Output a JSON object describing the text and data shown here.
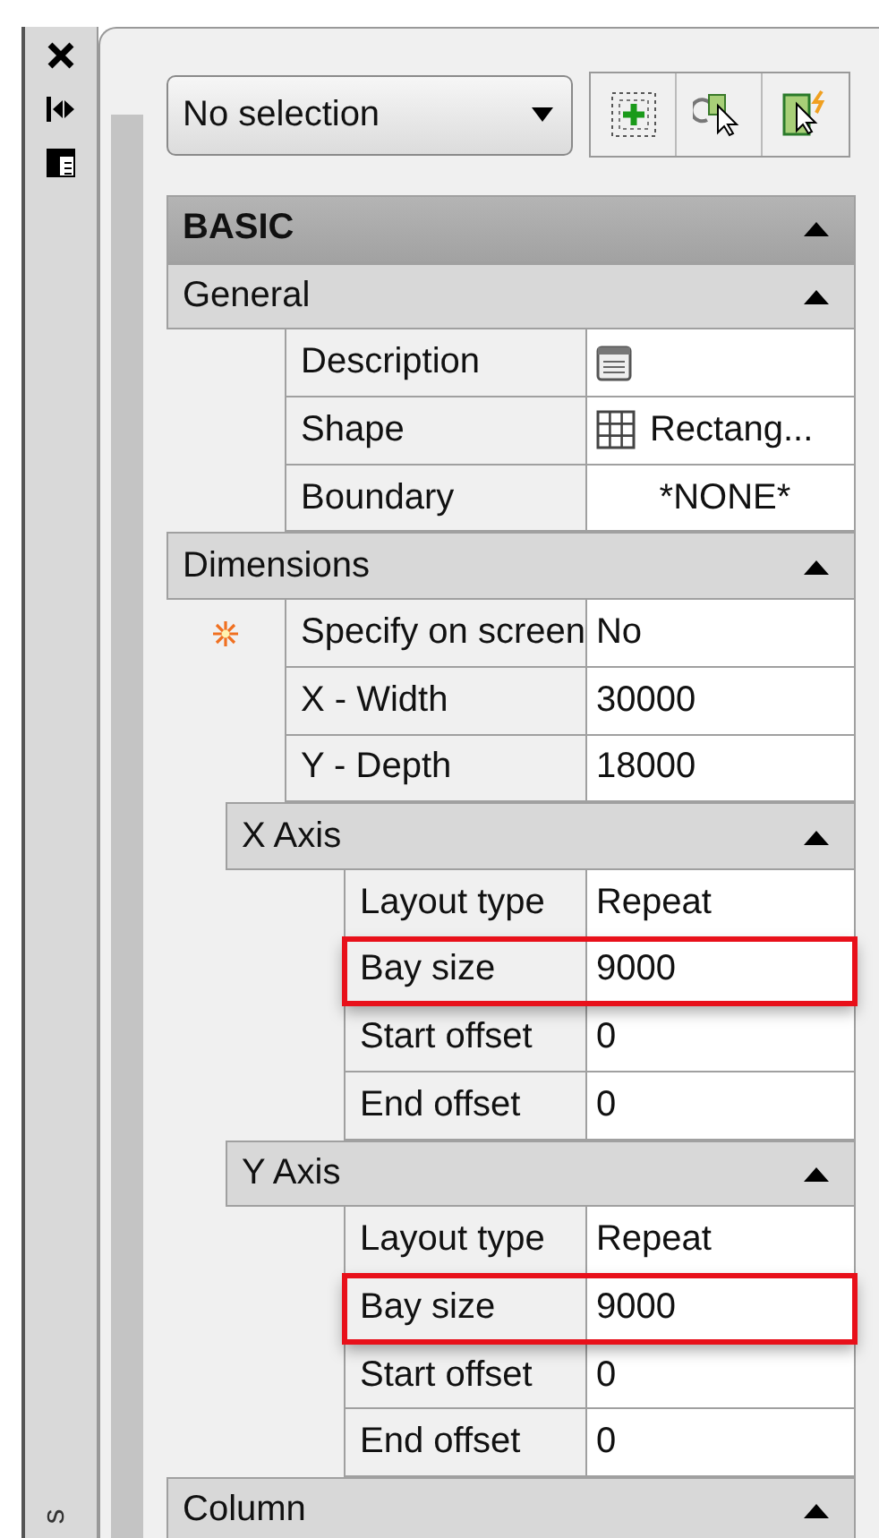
{
  "side_toolbar": {
    "label": "s"
  },
  "selection": {
    "value": "No selection"
  },
  "properties": [
    {
      "kind": "category",
      "title": "BASIC",
      "expanded": true,
      "children": [
        {
          "kind": "group",
          "title": "General",
          "expanded": true,
          "children": [
            {
              "kind": "editor",
              "label": "Description",
              "flagged": false,
              "highlighted": false
            },
            {
              "kind": "shape",
              "label": "Shape",
              "value": "Rectang...",
              "flagged": false,
              "highlighted": false
            },
            {
              "kind": "centered",
              "label": "Boundary",
              "value": "*NONE*",
              "flagged": false,
              "highlighted": false
            }
          ]
        },
        {
          "kind": "group",
          "title": "Dimensions",
          "expanded": true,
          "children": [
            {
              "kind": "text",
              "label": "Specify on screen",
              "value": "No",
              "flagged": true,
              "highlighted": false
            },
            {
              "kind": "text",
              "label": "X - Width",
              "value": "30000",
              "flagged": false,
              "highlighted": false
            },
            {
              "kind": "text",
              "label": "Y - Depth",
              "value": "18000",
              "flagged": false,
              "highlighted": false
            },
            {
              "kind": "group",
              "title": "X Axis",
              "expanded": true,
              "children": [
                {
                  "kind": "text",
                  "label": "Layout type",
                  "value": "Repeat",
                  "flagged": false,
                  "highlighted": false
                },
                {
                  "kind": "text",
                  "label": "Bay size",
                  "value": "9000",
                  "flagged": false,
                  "highlighted": true
                },
                {
                  "kind": "text",
                  "label": "Start offset",
                  "value": "0",
                  "flagged": false,
                  "highlighted": false
                },
                {
                  "kind": "text",
                  "label": "End offset",
                  "value": "0",
                  "flagged": false,
                  "highlighted": false
                }
              ]
            },
            {
              "kind": "group",
              "title": "Y Axis",
              "expanded": true,
              "children": [
                {
                  "kind": "text",
                  "label": "Layout type",
                  "value": "Repeat",
                  "flagged": false,
                  "highlighted": false
                },
                {
                  "kind": "text",
                  "label": "Bay size",
                  "value": "9000",
                  "flagged": false,
                  "highlighted": true
                },
                {
                  "kind": "text",
                  "label": "Start offset",
                  "value": "0",
                  "flagged": false,
                  "highlighted": false
                },
                {
                  "kind": "text",
                  "label": "End offset",
                  "value": "0",
                  "flagged": false,
                  "highlighted": false
                }
              ]
            }
          ]
        },
        {
          "kind": "group",
          "title": "Column",
          "expanded": true
        }
      ]
    }
  ]
}
